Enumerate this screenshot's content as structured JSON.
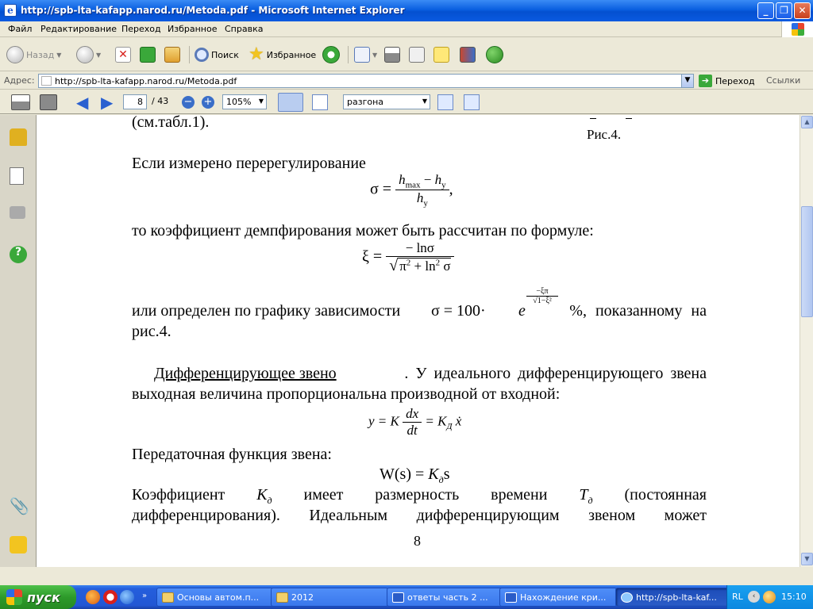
{
  "window": {
    "title": "http://spb-lta-kafapp.narod.ru/Metoda.pdf - Microsoft Internet Explorer"
  },
  "menu": {
    "items": [
      "Файл",
      "Редактирование",
      "Переход",
      "Избранное",
      "Справка"
    ]
  },
  "toolbar": {
    "back_label": "Назад",
    "search_label": "Поиск",
    "favorites_label": "Избранное"
  },
  "address": {
    "label": "Адрес:",
    "url": "http://spb-lta-kafapp.narod.ru/Metoda.pdf",
    "go_label": "Переход",
    "links_label": "Ссылки"
  },
  "pdf_toolbar": {
    "page_current": "8",
    "page_total": "/ 43",
    "zoom": "105%",
    "search_text": "разгона"
  },
  "document": {
    "line1": "(см.табл.1).",
    "fig_caption": "Рис.4.",
    "p_overshoot": "Если измерено перерегулирование",
    "eq1": {
      "lhs": "σ =",
      "num_a": "h",
      "num_a_sub": "max",
      "num_op": " − ",
      "num_b": "h",
      "num_b_sub": "y",
      "den": "h",
      "den_sub": "y",
      "tail": ","
    },
    "p_damping": "то коэффициент демпфирования может быть рассчитан по формуле:",
    "eq2": {
      "lhs": "ξ =",
      "num": "− lnσ",
      "den_a": "π",
      "den_a_sup": "2",
      "den_op": " + ln",
      "den_b_sup": "2",
      "den_b": " σ"
    },
    "p_graph_a": "или определен по графику зависимости",
    "p_graph_eq": "σ = 100·",
    "p_graph_e": "e",
    "p_graph_exp_num": "−ξπ",
    "p_graph_exp_den": "√1−ξ²",
    "p_graph_b": "%, показанному на",
    "p_graph_c": "рис.4.",
    "section_title": "Дифференцирующее звено",
    "p_section_a": ". У идеального дифференцирующего звена",
    "p_section_b": "выходная величина пропорциональна производной от входной:",
    "eq3": {
      "lhs": "y = K",
      "num": "dx",
      "den": "dt",
      "mid": " = K",
      "sub": "Д",
      "var": " ẋ"
    },
    "p_transfer": "Передаточная функция звена:",
    "eq4": {
      "a": "W(s) = ",
      "k": "K",
      "sub": "д",
      "s": "s"
    },
    "p_coef_words": [
      "Коэффициент",
      "K",
      "д",
      "имеет",
      "размерность",
      "времени",
      "T",
      "д",
      "(постоянная"
    ],
    "p_coef_b": "дифференцирования). Идеальным дифференцирующим звеном может",
    "page_number": "8"
  },
  "taskbar": {
    "start_label": "пуск",
    "tasks": [
      "Основы автом.п...",
      "2012",
      "ответы часть 2 ...",
      "Нахождение кри...",
      "http://spb-lta-kaf..."
    ],
    "lang": "RL",
    "clock": "15:10"
  }
}
